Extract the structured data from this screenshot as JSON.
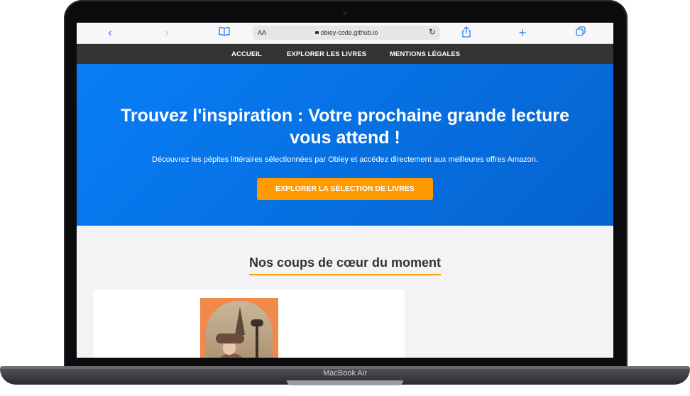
{
  "device": {
    "label": "MacBook Air"
  },
  "browser": {
    "text_size_label": "AA",
    "url": "obiey-code.github.io",
    "icons": [
      "back-icon",
      "forward-icon",
      "bookmarks-icon",
      "lock-icon",
      "reload-icon",
      "share-icon",
      "new-tab-icon",
      "tabs-icon"
    ]
  },
  "nav": {
    "items": [
      {
        "label": "ACCUEIL"
      },
      {
        "label": "EXPLORER LES LIVRES"
      },
      {
        "label": "MENTIONS LÉGALES"
      }
    ]
  },
  "hero": {
    "title_line1": "Trouvez l'inspiration : Votre prochaine grande lecture",
    "title_line2": "vous attend !",
    "subtitle": "Découvrez les pépites littéraires sélectionnées par Obiey et accédez directement aux meilleures offres Amazon.",
    "cta_label": "EXPLORER LA SÉLECTION DE LIVRES"
  },
  "section": {
    "title": "Nos coups de cœur du moment"
  },
  "colors": {
    "accent": "#ff9a00",
    "hero_start": "#087ef7",
    "hero_end": "#0563ce",
    "nav_bg": "#333333",
    "safari_blue": "#2f7bf5"
  }
}
